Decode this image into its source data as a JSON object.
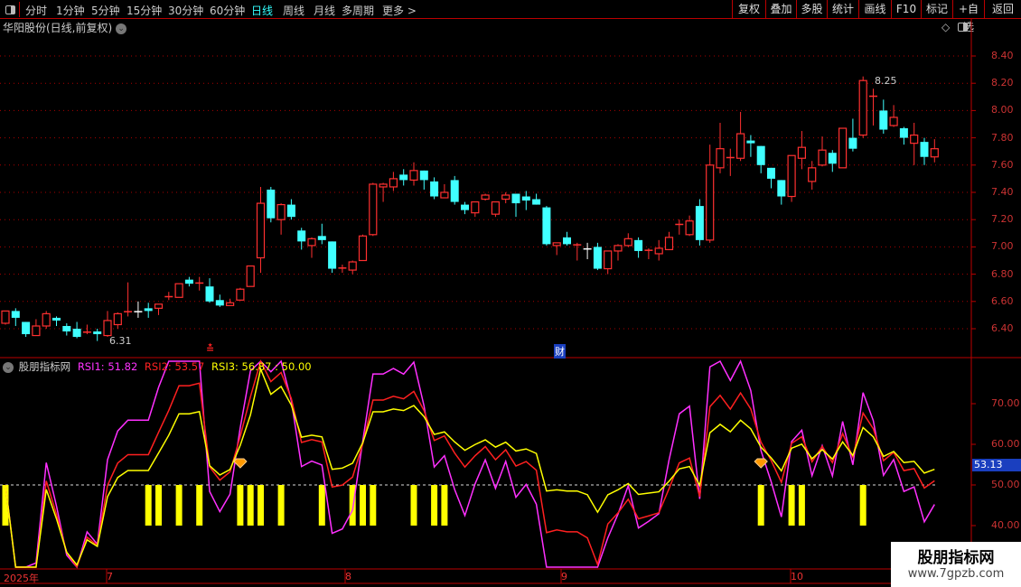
{
  "toolbar": {
    "periods": [
      "分时",
      "1分钟",
      "5分钟",
      "15分钟",
      "30分钟",
      "60分钟",
      "日线",
      "周线",
      "月线",
      "多周期",
      "更多 >"
    ],
    "active_period": "日线",
    "right_buttons": [
      "复权",
      "叠加",
      "多股",
      "统计",
      "画线",
      "F10",
      "标记",
      "+自选",
      "返回"
    ]
  },
  "header": {
    "title": "华阳股份(日线,前复权)"
  },
  "main_axis": [
    "8.40",
    "8.20",
    "8.00",
    "7.80",
    "7.60",
    "7.40",
    "7.20",
    "7.00",
    "6.80",
    "6.60",
    "6.40"
  ],
  "annotations": {
    "low_label": "6.31",
    "high_label": "8.25",
    "event_marker": "财"
  },
  "indicator": {
    "name": "股朋指标网",
    "rsi1": "RSI1: 51.82",
    "rsi2": "RSI2: 53.57",
    "rsi3": "RSI3: 56.87",
    "level": " : 50.00",
    "axis": [
      "70.00",
      "60.00",
      "50.00",
      "40.00"
    ],
    "current_value": "53.13",
    "signal_bar_indices": [
      0,
      14,
      15,
      17,
      19,
      23,
      24,
      25,
      27,
      31,
      34,
      35,
      36,
      40,
      42,
      43,
      74,
      77,
      78,
      84
    ],
    "diamond_indices": [
      23,
      74
    ]
  },
  "colors": {
    "up": "#ff3030",
    "down": "#40ffff",
    "rsi1": "#ff30ff",
    "rsi2": "#ff2020",
    "rsi3": "#ffff00",
    "signal": "#ffff00"
  },
  "dates": [
    "2025年",
    "7",
    "8",
    "9",
    "10"
  ],
  "watermark": {
    "name": "股朋指标网",
    "url": "www.7gpzb.com"
  },
  "chart_data": {
    "type": "candlestick",
    "ohlc": [
      [
        6.44,
        6.53,
        6.43,
        6.53
      ],
      [
        6.53,
        6.55,
        6.42,
        6.48
      ],
      [
        6.45,
        6.45,
        6.34,
        6.36
      ],
      [
        6.35,
        6.47,
        6.35,
        6.42
      ],
      [
        6.42,
        6.53,
        6.4,
        6.51
      ],
      [
        6.48,
        6.49,
        6.42,
        6.46
      ],
      [
        6.42,
        6.44,
        6.35,
        6.38
      ],
      [
        6.4,
        6.45,
        6.33,
        6.34
      ],
      [
        6.37,
        6.43,
        6.36,
        6.38
      ],
      [
        6.38,
        6.4,
        6.31,
        6.36
      ],
      [
        6.35,
        6.53,
        6.34,
        6.46
      ],
      [
        6.43,
        6.52,
        6.4,
        6.51
      ],
      [
        6.52,
        6.74,
        6.49,
        6.53
      ],
      [
        6.53,
        6.6,
        6.48,
        6.53
      ],
      [
        6.55,
        6.59,
        6.48,
        6.53
      ],
      [
        6.55,
        6.58,
        6.5,
        6.58
      ],
      [
        6.64,
        6.67,
        6.61,
        6.64
      ],
      [
        6.63,
        6.73,
        6.63,
        6.73
      ],
      [
        6.76,
        6.78,
        6.71,
        6.73
      ],
      [
        6.73,
        6.78,
        6.68,
        6.74
      ],
      [
        6.71,
        6.77,
        6.59,
        6.6
      ],
      [
        6.61,
        6.65,
        6.56,
        6.57
      ],
      [
        6.57,
        6.62,
        6.57,
        6.59
      ],
      [
        6.61,
        6.7,
        6.61,
        6.69
      ],
      [
        6.71,
        6.86,
        6.71,
        6.86
      ],
      [
        6.92,
        7.44,
        6.81,
        7.32
      ],
      [
        7.42,
        7.44,
        7.18,
        7.21
      ],
      [
        7.2,
        7.32,
        7.09,
        7.31
      ],
      [
        7.31,
        7.35,
        7.2,
        7.22
      ],
      [
        7.12,
        7.14,
        6.98,
        7.04
      ],
      [
        7.01,
        7.07,
        6.92,
        7.06
      ],
      [
        7.08,
        7.17,
        7.02,
        7.05
      ],
      [
        7.04,
        7.04,
        6.81,
        6.84
      ],
      [
        6.84,
        6.87,
        6.81,
        6.85
      ],
      [
        6.83,
        6.9,
        6.8,
        6.89
      ],
      [
        6.9,
        7.09,
        6.9,
        7.08
      ],
      [
        7.09,
        7.47,
        7.08,
        7.46
      ],
      [
        7.44,
        7.47,
        7.33,
        7.46
      ],
      [
        7.44,
        7.55,
        7.41,
        7.5
      ],
      [
        7.53,
        7.57,
        7.45,
        7.49
      ],
      [
        7.49,
        7.62,
        7.45,
        7.56
      ],
      [
        7.56,
        7.56,
        7.42,
        7.49
      ],
      [
        7.48,
        7.51,
        7.35,
        7.37
      ],
      [
        7.36,
        7.46,
        7.36,
        7.4
      ],
      [
        7.49,
        7.52,
        7.31,
        7.33
      ],
      [
        7.31,
        7.33,
        7.24,
        7.27
      ],
      [
        7.25,
        7.33,
        7.22,
        7.33
      ],
      [
        7.35,
        7.39,
        7.34,
        7.38
      ],
      [
        7.24,
        7.33,
        7.22,
        7.33
      ],
      [
        7.35,
        7.4,
        7.32,
        7.38
      ],
      [
        7.39,
        7.39,
        7.22,
        7.32
      ],
      [
        7.37,
        7.41,
        7.27,
        7.34
      ],
      [
        7.35,
        7.39,
        7.31,
        7.31
      ],
      [
        7.29,
        7.3,
        7.01,
        7.02
      ],
      [
        7.01,
        7.03,
        6.94,
        7.03
      ],
      [
        7.07,
        7.11,
        7.01,
        7.02
      ],
      [
        7.02,
        7.03,
        6.9,
        7.02
      ],
      [
        6.99,
        7.03,
        6.91,
        6.99
      ],
      [
        7.0,
        7.03,
        6.83,
        6.84
      ],
      [
        6.84,
        6.97,
        6.8,
        6.97
      ],
      [
        6.97,
        7.02,
        6.9,
        7.01
      ],
      [
        7.01,
        7.1,
        7.0,
        7.06
      ],
      [
        7.05,
        7.07,
        6.92,
        6.97
      ],
      [
        6.97,
        6.99,
        6.91,
        6.98
      ],
      [
        6.95,
        7.05,
        6.9,
        6.99
      ],
      [
        6.98,
        7.11,
        6.98,
        7.07
      ],
      [
        7.17,
        7.2,
        7.09,
        7.17
      ],
      [
        7.09,
        7.23,
        7.08,
        7.19
      ],
      [
        7.3,
        7.35,
        7.01,
        7.05
      ],
      [
        7.05,
        7.75,
        7.03,
        7.6
      ],
      [
        7.58,
        7.91,
        7.54,
        7.72
      ],
      [
        7.65,
        7.72,
        7.52,
        7.66
      ],
      [
        7.65,
        7.99,
        7.63,
        7.83
      ],
      [
        7.78,
        7.82,
        7.66,
        7.76
      ],
      [
        7.74,
        7.74,
        7.54,
        7.6
      ],
      [
        7.58,
        7.58,
        7.43,
        7.5
      ],
      [
        7.49,
        7.49,
        7.31,
        7.37
      ],
      [
        7.37,
        7.67,
        7.33,
        7.67
      ],
      [
        7.65,
        7.85,
        7.57,
        7.73
      ],
      [
        7.48,
        7.63,
        7.42,
        7.58
      ],
      [
        7.6,
        7.81,
        7.59,
        7.71
      ],
      [
        7.69,
        7.71,
        7.55,
        7.61
      ],
      [
        7.58,
        7.87,
        7.58,
        7.87
      ],
      [
        7.8,
        7.94,
        7.7,
        7.72
      ],
      [
        7.82,
        8.25,
        7.8,
        8.22
      ],
      [
        8.1,
        8.16,
        7.89,
        8.11
      ],
      [
        8.0,
        8.08,
        7.83,
        7.86
      ],
      [
        7.89,
        8.04,
        7.88,
        7.95
      ],
      [
        7.87,
        7.88,
        7.75,
        7.8
      ],
      [
        7.76,
        7.91,
        7.6,
        7.82
      ],
      [
        7.77,
        7.8,
        7.6,
        7.66
      ],
      [
        7.66,
        7.79,
        7.62,
        7.72
      ]
    ],
    "price_range": [
      6.25,
      8.55
    ],
    "indicator_range": [
      30,
      80
    ]
  }
}
